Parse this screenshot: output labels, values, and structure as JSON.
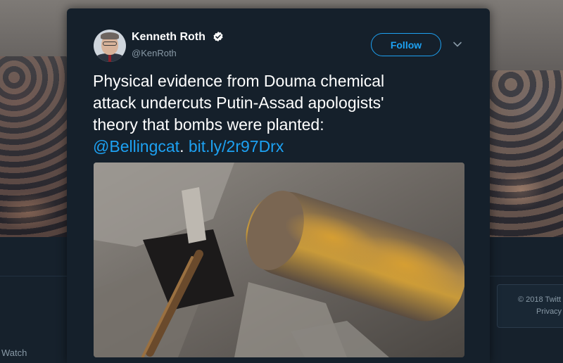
{
  "tweet": {
    "author": {
      "display_name": "Kenneth Roth",
      "handle": "@KenRoth",
      "verified": true
    },
    "follow_label": "Follow",
    "text": {
      "line1": "Physical evidence from Douma chemical",
      "line2": "attack undercuts Putin-Assad apologists'",
      "line3": "theory that bombs were planted:",
      "mention": "@Bellingcat",
      "separator": ". ",
      "link": "bit.ly/2r97Drx"
    },
    "media": {
      "description_icon": "photo-icon"
    }
  },
  "background": {
    "footer_copyright": "© 2018 Twitt",
    "footer_privacy": "Privacy",
    "left_label": "Watch"
  },
  "colors": {
    "accent": "#1da1f2",
    "card_background": "#15202b",
    "secondary_text": "#8899a6",
    "primary_text": "#ffffff"
  },
  "icons": {
    "verified": "verified-badge-icon",
    "more": "chevron-down-icon"
  }
}
